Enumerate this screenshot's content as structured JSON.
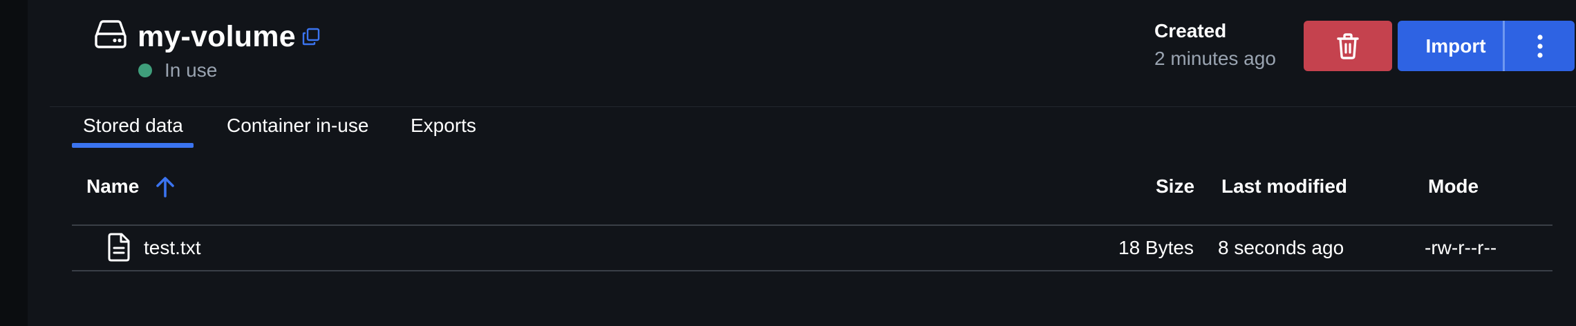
{
  "header": {
    "title": "my-volume",
    "status": "In use",
    "created_label": "Created",
    "created_value": "2 minutes ago",
    "import_label": "Import"
  },
  "tabs": [
    {
      "label": "Stored data",
      "active": true
    },
    {
      "label": "Container in-use",
      "active": false
    },
    {
      "label": "Exports",
      "active": false
    }
  ],
  "table": {
    "columns": {
      "name": "Name",
      "size": "Size",
      "modified": "Last modified",
      "mode": "Mode"
    },
    "sort": "name-ascending",
    "rows": [
      {
        "name": "test.txt",
        "size": "18 Bytes",
        "modified": "8 seconds ago",
        "mode": "-rw-r--r--"
      }
    ]
  },
  "colors": {
    "background": "#111419",
    "accent": "#3b74f0",
    "danger": "#c5424e",
    "status_ok": "#3f9e7b"
  },
  "icons": [
    "volume-icon",
    "copy-icon",
    "trash-icon",
    "more-vertical-icon",
    "arrow-up-icon",
    "file-icon"
  ]
}
